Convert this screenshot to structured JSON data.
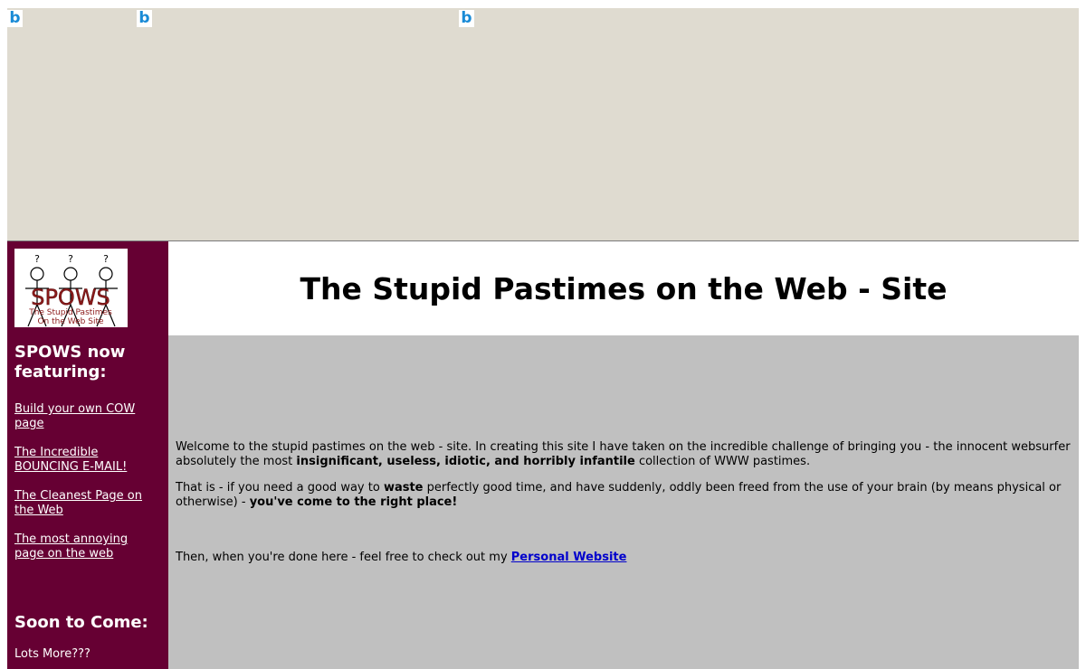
{
  "ad_banner": {
    "icons": [
      "bing-icon",
      "bing-icon",
      "bing-icon"
    ],
    "icon_glyph": "b"
  },
  "logo": {
    "big_text": "SPOWS",
    "line1": "The Stupid Pastimes",
    "line2": "On the Web Site",
    "marks": [
      "?",
      "?",
      "?"
    ]
  },
  "sidebar": {
    "heading": "SPOWS now featuring:",
    "links": [
      "Build your own COW page",
      "The Incredible BOUNCING E-MAIL!",
      "The Cleanest Page on the Web",
      "The most annoying page on the web"
    ],
    "soon_heading": "Soon to Come:",
    "soon_text": "Lots More???"
  },
  "header": {
    "title": "The Stupid Pastimes on the Web - Site"
  },
  "main": {
    "p1_a": "Welcome to the stupid pastimes on the web - site. In creating this site I have taken on the incredible challenge of bringing you - the innocent websurfer absolutely the most ",
    "p1_bold": "insignificant, useless, idiotic, and horribly infantile",
    "p1_b": " collection of WWW pastimes.",
    "p2_a": "That is - if you need a good way to ",
    "p2_bold1": "waste",
    "p2_b": " perfectly good time, and have suddenly, oddly been freed from the use of your brain (by means physical or otherwise) - ",
    "p2_bold2": "you've come to the right place!",
    "p3_a": "Then, when you're done here - feel free to check out my ",
    "p3_link": "Personal Website"
  },
  "colors": {
    "sidebar_bg": "#660033",
    "content_bg": "#c0c0c0",
    "banner_bg": "#dfdbd0",
    "link": "#0000cc",
    "logo_text": "#8b1a1a"
  }
}
